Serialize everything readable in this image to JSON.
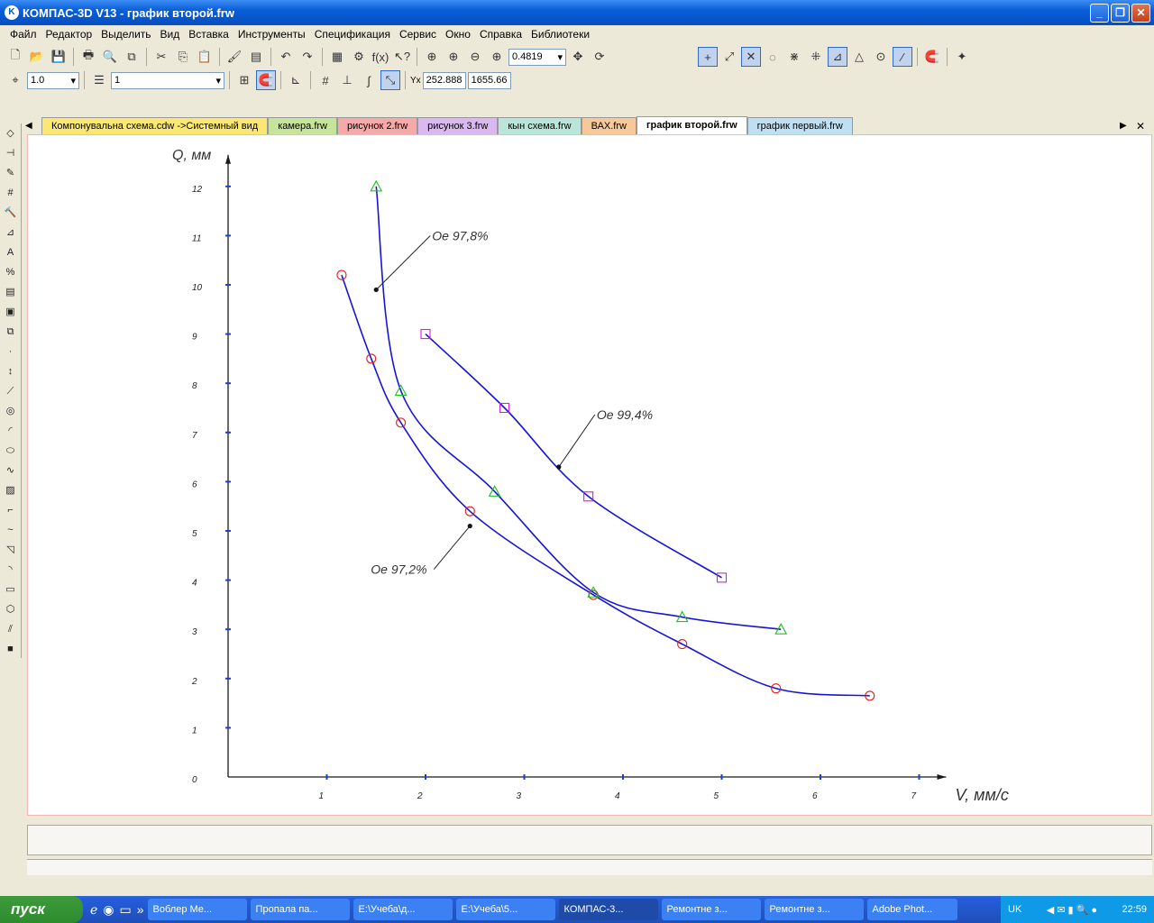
{
  "window": {
    "title": "КОМПАС-3D V13 - график второй.frw",
    "app_icon": "K"
  },
  "menu": [
    "Файл",
    "Редактор",
    "Выделить",
    "Вид",
    "Вставка",
    "Инструменты",
    "Спецификация",
    "Сервис",
    "Окно",
    "Справка",
    "Библиотеки"
  ],
  "toolbar": {
    "zoom": "0.4819",
    "step": "1.0",
    "layer": "1",
    "coord_y": "252.888",
    "coord_x": "1655.66"
  },
  "tabs": [
    {
      "label": "Компонувальна  схема.cdw ->Системный вид",
      "color": "#fbe874"
    },
    {
      "label": "камера.frw",
      "color": "#c6e59a"
    },
    {
      "label": "рисунок 2.frw",
      "color": "#f5a9a9"
    },
    {
      "label": "рисунок 3.frw",
      "color": "#d9b9f0"
    },
    {
      "label": "кын схема.frw",
      "color": "#b9e6d9"
    },
    {
      "label": "ВАХ.frw",
      "color": "#f7c99a"
    },
    {
      "label": "график второй.frw",
      "color": "#ffffff",
      "active": true
    },
    {
      "label": "график первый.frw",
      "color": "#bfe0f3"
    }
  ],
  "chart_data": {
    "type": "line",
    "xlabel": "V, мм/с",
    "ylabel": "Q, мм",
    "xlim": [
      0,
      7
    ],
    "ylim": [
      0,
      12
    ],
    "x_ticks": [
      "1",
      "2",
      "3",
      "4",
      "5",
      "6",
      "7"
    ],
    "y_ticks": [
      "0",
      "1",
      "2",
      "3",
      "4",
      "5",
      "6",
      "7",
      "8",
      "9",
      "10",
      "11",
      "12"
    ],
    "series": [
      {
        "name": "Oe 97,2%",
        "marker": "circle",
        "color": "#e81c1c",
        "points": [
          [
            1.15,
            10.2
          ],
          [
            1.45,
            8.5
          ],
          [
            1.75,
            7.2
          ],
          [
            2.45,
            5.4
          ],
          [
            3.7,
            3.7
          ],
          [
            4.6,
            2.7
          ],
          [
            5.55,
            1.8
          ],
          [
            6.5,
            1.65
          ]
        ]
      },
      {
        "name": "Oe 97,8%",
        "marker": "triangle",
        "color": "#1fc21f",
        "points": [
          [
            1.5,
            12.0
          ],
          [
            1.75,
            7.85
          ],
          [
            2.7,
            5.8
          ],
          [
            3.7,
            3.75
          ],
          [
            4.6,
            3.25
          ],
          [
            5.6,
            3.0
          ]
        ]
      },
      {
        "name": "Oe 99,4%",
        "marker": "square",
        "color": "#d81bd8",
        "points": [
          [
            2.0,
            9.0
          ],
          [
            2.8,
            7.5
          ],
          [
            3.65,
            5.7
          ],
          [
            5.0,
            4.05
          ]
        ]
      }
    ],
    "annotations": [
      {
        "text": "Oe 97,8%",
        "x": 1.5,
        "y": 9.9
      },
      {
        "text": "Oe 99,4%",
        "x": 3.35,
        "y": 6.3
      },
      {
        "text": "Oe 97,2%",
        "x": 2.45,
        "y": 5.1
      }
    ]
  },
  "taskbar": {
    "start": "пуск",
    "tasks": [
      "Воблер Ме...",
      "Пропала па...",
      "E:\\Учеба\\д...",
      "E:\\Учеба\\5...",
      "КОМПАС-3...",
      "Ремонтне з...",
      "Ремонтне з...",
      "Adobe Phot..."
    ],
    "lang": "UK",
    "clock": "22:59"
  }
}
